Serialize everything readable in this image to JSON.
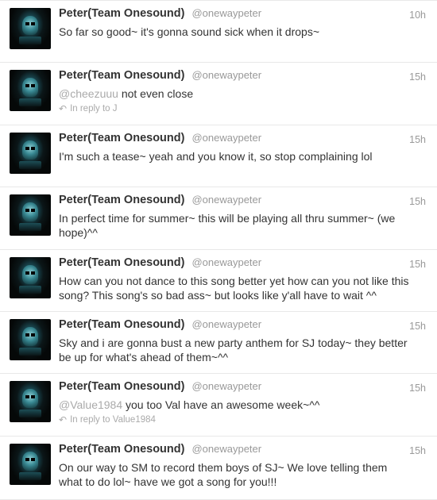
{
  "tweets": [
    {
      "name": "Peter(Team Onesound)",
      "handle": "@onewaypeter",
      "time": "10h",
      "mention": "",
      "text": "So far so good~ it's gonna sound sick when it drops~",
      "reply": ""
    },
    {
      "name": "Peter(Team Onesound)",
      "handle": "@onewaypeter",
      "time": "15h",
      "mention": "@cheezuuu",
      "text": " not even close",
      "reply": "In reply to J"
    },
    {
      "name": "Peter(Team Onesound)",
      "handle": "@onewaypeter",
      "time": "15h",
      "mention": "",
      "text": "I'm such a tease~ yeah and you know it, so stop complaining lol",
      "reply": ""
    },
    {
      "name": "Peter(Team Onesound)",
      "handle": "@onewaypeter",
      "time": "15h",
      "mention": "",
      "text": "In perfect time for summer~ this will be playing all thru summer~ (we hope)^^",
      "reply": ""
    },
    {
      "name": "Peter(Team Onesound)",
      "handle": "@onewaypeter",
      "time": "15h",
      "mention": "",
      "text": "How can you not dance to this song better yet how can you not like this song? This song's so bad ass~ but looks like y'all have to wait ^^",
      "reply": ""
    },
    {
      "name": "Peter(Team Onesound)",
      "handle": "@onewaypeter",
      "time": "15h",
      "mention": "",
      "text": "Sky and i are gonna bust a new party anthem for SJ today~ they better be up for what's ahead of them~^^",
      "reply": ""
    },
    {
      "name": "Peter(Team Onesound)",
      "handle": "@onewaypeter",
      "time": "15h",
      "mention": "@Value1984",
      "text": " you too Val have an awesome week~^^",
      "reply": "In reply to Value1984"
    },
    {
      "name": "Peter(Team Onesound)",
      "handle": "@onewaypeter",
      "time": "15h",
      "mention": "",
      "text": "On our way to SM to record them boys of SJ~ We love telling them what to do lol~ have we got a song for you!!!",
      "reply": ""
    }
  ]
}
